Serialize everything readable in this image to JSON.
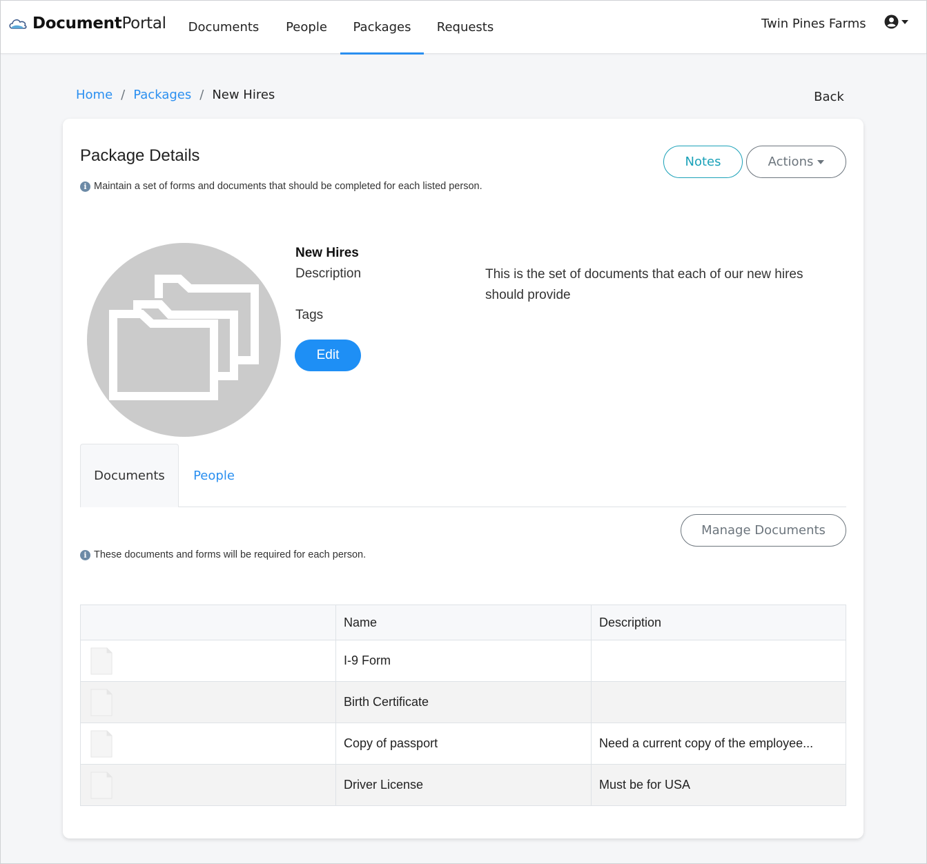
{
  "navbar": {
    "brand_bold": "Document",
    "brand_light": "Portal",
    "links": [
      {
        "label": "Documents",
        "active": false
      },
      {
        "label": "People",
        "active": false
      },
      {
        "label": "Packages",
        "active": true
      },
      {
        "label": "Requests",
        "active": false
      }
    ],
    "org_name": "Twin Pines Farms",
    "accent_color": "#2a8ff0"
  },
  "breadcrumb": {
    "items": [
      "Home",
      "Packages"
    ],
    "current": "New Hires",
    "separator": "/"
  },
  "back_label": "Back",
  "card": {
    "title": "Package Details",
    "info": "Maintain a set of forms and documents that should be completed for each listed person.",
    "notes_label": "Notes",
    "actions_label": "Actions",
    "package": {
      "name": "New Hires",
      "description_label": "Description",
      "description": "This is the set of documents that each of our new hires should provide",
      "tags_label": "Tags",
      "tags": "",
      "edit_label": "Edit",
      "avatar_icon": "folders-icon"
    },
    "tabs": [
      {
        "label": "Documents",
        "active": true
      },
      {
        "label": "People",
        "active": false
      }
    ],
    "documents_info": "These documents and forms will be required for each person.",
    "manage_documents_label": "Manage Documents",
    "table": {
      "columns": [
        "",
        "Name",
        "Description"
      ],
      "rows": [
        {
          "icon": "file-icon",
          "name": "I-9 Form",
          "description": ""
        },
        {
          "icon": "file-icon",
          "name": "Birth Certificate",
          "description": ""
        },
        {
          "icon": "file-icon",
          "name": "Copy of passport",
          "description": "Need a current copy of the employee..."
        },
        {
          "icon": "file-icon",
          "name": "Driver License",
          "description": "Must be for USA"
        }
      ]
    }
  }
}
